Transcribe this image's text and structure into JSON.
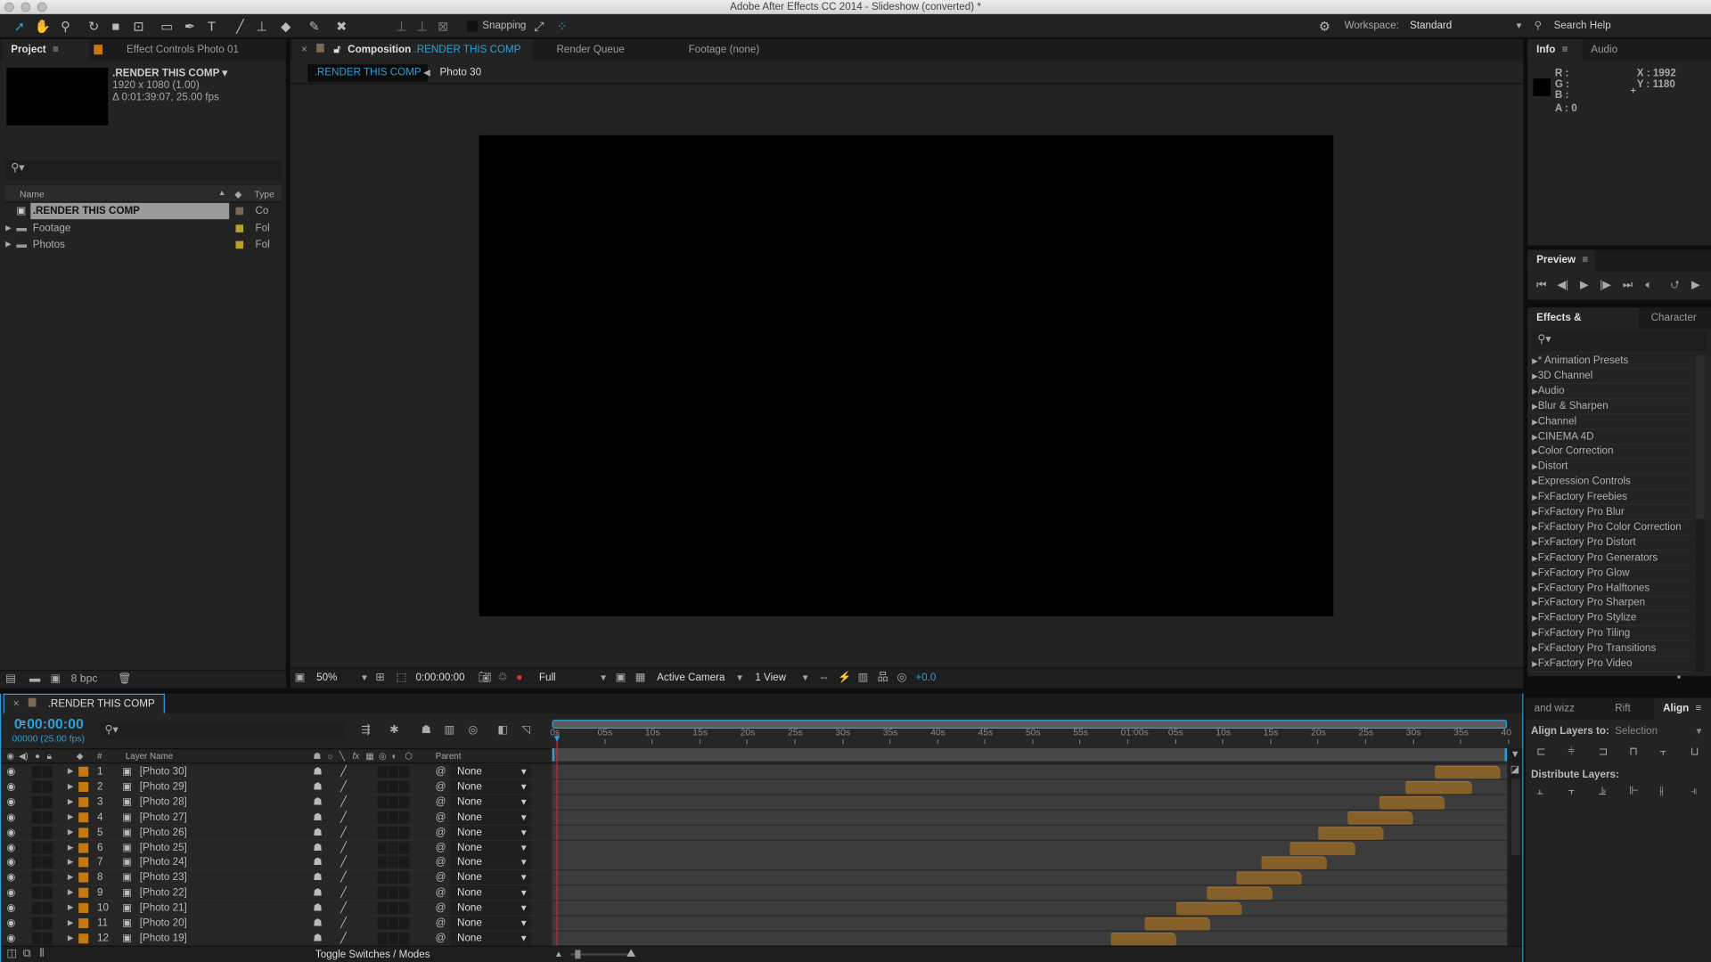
{
  "window": {
    "title": "Adobe After Effects CC 2014 - Slideshow (converted) *"
  },
  "toolbar": {
    "tools": [
      "selection-tool",
      "hand-tool",
      "zoom-tool",
      "rotation-tool",
      "camera-tool",
      "pan-behind-tool",
      "rectangle-tool",
      "pen-tool",
      "type-tool",
      "brush-tool",
      "clone-stamp-tool",
      "eraser-tool",
      "roto-brush-tool",
      "puppet-pin-tool"
    ],
    "snapping_label": "Snapping",
    "workspace_label": "Workspace:",
    "workspace_value": "Standard",
    "search_help": "Search Help"
  },
  "project": {
    "tab_project": "Project",
    "tab_effect_controls": "Effect Controls Photo 01",
    "comp_name": ".RENDER THIS COMP ▾",
    "comp_size": "1920 x 1080 (1.00)",
    "comp_duration": "Δ 0:01:39:07, 25.00 fps",
    "col_name": "Name",
    "col_type": "Type",
    "items": [
      {
        "name": ".RENDER THIS COMP",
        "type": "Co",
        "kind": "comp",
        "label_color": "#7a6a55",
        "selected": true
      },
      {
        "name": "Footage",
        "type": "Fol",
        "kind": "folder",
        "label_color": "#b8a22a"
      },
      {
        "name": "Photos",
        "type": "Fol",
        "kind": "folder",
        "label_color": "#b8a22a"
      }
    ],
    "bpc": "8 bpc"
  },
  "composition": {
    "tab_label": "Composition",
    "tab_comp": ".RENDER THIS COMP",
    "tab_render_queue": "Render Queue",
    "tab_footage": "Footage (none)",
    "breadcrumb_active": ".RENDER THIS COMP",
    "breadcrumb_next": "Photo 30",
    "zoom": "50%",
    "timecode": "0:00:00:00",
    "resolution": "Full",
    "camera": "Active Camera",
    "views": "1 View",
    "exposure": "+0.0"
  },
  "info": {
    "tab_info": "Info",
    "tab_audio": "Audio",
    "r": "R :",
    "g": "G :",
    "b": "B :",
    "a": "A : 0",
    "x": "X : 1992",
    "y": "Y : 1180"
  },
  "preview": {
    "tab": "Preview"
  },
  "effects": {
    "tab": "Effects & Presets",
    "tab_character": "Character",
    "items": [
      "* Animation Presets",
      "3D Channel",
      "Audio",
      "Blur & Sharpen",
      "Channel",
      "CINEMA 4D",
      "Color Correction",
      "Distort",
      "Expression Controls",
      "FxFactory Freebies",
      "FxFactory Pro Blur",
      "FxFactory Pro Color Correction",
      "FxFactory Pro Distort",
      "FxFactory Pro Generators",
      "FxFactory Pro Glow",
      "FxFactory Pro Halftones",
      "FxFactory Pro Sharpen",
      "FxFactory Pro Stylize",
      "FxFactory Pro Tiling",
      "FxFactory Pro Transitions",
      "FxFactory Pro Video"
    ]
  },
  "align": {
    "tab_wizz": "and wizz",
    "tab_rift": "Rift",
    "tab_align": "Align",
    "align_to_label": "Align Layers to:",
    "align_to_value": "Selection",
    "distribute_label": "Distribute Layers:"
  },
  "timeline": {
    "tab": ".RENDER THIS COMP",
    "timecode": "0:00:00:00",
    "frame": "00000 (25.00 fps)",
    "col_layer_name": "Layer Name",
    "col_num": "#",
    "col_parent": "Parent",
    "toggle_label": "Toggle Switches / Modes",
    "ruler_labels": [
      "0s",
      "05s",
      "10s",
      "15s",
      "20s",
      "25s",
      "30s",
      "35s",
      "40s",
      "45s",
      "50s",
      "55s",
      "01:00s",
      "05s",
      "10s",
      "15s",
      "20s",
      "25s",
      "30s",
      "35s",
      "40"
    ],
    "current_time_s": 0,
    "label_color": "#c47a13",
    "layers": [
      {
        "num": "1",
        "name": "[Photo 30]",
        "parent": "None",
        "in_s": 92.3,
        "out_s": 99.2
      },
      {
        "num": "2",
        "name": "[Photo 29]",
        "parent": "None",
        "in_s": 89.3,
        "out_s": 96.2
      },
      {
        "num": "3",
        "name": "[Photo 28]",
        "parent": "None",
        "in_s": 86.5,
        "out_s": 93.4
      },
      {
        "num": "4",
        "name": "[Photo 27]",
        "parent": "None",
        "in_s": 83.2,
        "out_s": 90.1
      },
      {
        "num": "5",
        "name": "[Photo 26]",
        "parent": "None",
        "in_s": 80.1,
        "out_s": 87.0
      },
      {
        "num": "6",
        "name": "[Photo 25]",
        "parent": "None",
        "in_s": 77.1,
        "out_s": 84.0
      },
      {
        "num": "7",
        "name": "[Photo 24]",
        "parent": "None",
        "in_s": 74.1,
        "out_s": 81.0
      },
      {
        "num": "8",
        "name": "[Photo 23]",
        "parent": "None",
        "in_s": 71.5,
        "out_s": 78.4
      },
      {
        "num": "9",
        "name": "[Photo 22]",
        "parent": "None",
        "in_s": 68.4,
        "out_s": 75.3
      },
      {
        "num": "10",
        "name": "[Photo 21]",
        "parent": "None",
        "in_s": 65.2,
        "out_s": 72.1
      },
      {
        "num": "11",
        "name": "[Photo 20]",
        "parent": "None",
        "in_s": 61.8,
        "out_s": 68.7
      },
      {
        "num": "12",
        "name": "[Photo 19]",
        "parent": "None",
        "in_s": 58.3,
        "out_s": 65.2
      }
    ]
  }
}
